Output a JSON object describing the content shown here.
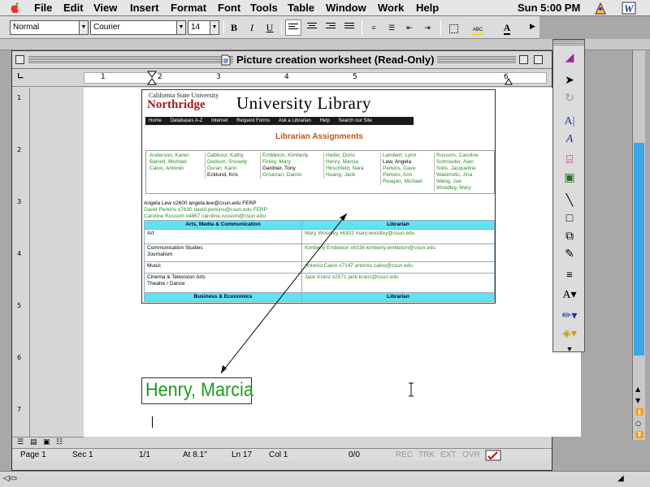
{
  "menubar": {
    "items": [
      "File",
      "Edit",
      "View",
      "Insert",
      "Format",
      "Font",
      "Tools",
      "Table",
      "Window",
      "Work",
      "Help"
    ],
    "clock": "Sun 5:00 PM"
  },
  "toolbar": {
    "style": "Normal",
    "font": "Courier",
    "size": "14",
    "bold": "B",
    "italic": "I",
    "underline": "U"
  },
  "window": {
    "title": "Picture creation worksheet (Read-Only)"
  },
  "ruler": {
    "marks": [
      "1",
      "2",
      "3",
      "4",
      "5",
      "6"
    ]
  },
  "vruler": {
    "marks": [
      "1",
      "2",
      "3",
      "4",
      "5",
      "6",
      "7"
    ]
  },
  "statusbar": {
    "page": "Page  1",
    "sec": "Sec  1",
    "pages": "1/1",
    "at": "At  8.1\"",
    "ln": "Ln  17",
    "col": "Col  1",
    "count": "0/0",
    "rec": "REC",
    "trk": "TRK",
    "ext": "EXT",
    "ovr": "OVR"
  },
  "picture": {
    "csu_line1": "California State University",
    "csu_line2": "Northridge",
    "library_title": "University Library",
    "nav": [
      "Home",
      "Databases A-Z",
      "Internet",
      "Request Forms",
      "Ask a Librarian",
      "Help",
      "Search our Site"
    ],
    "heading": "Librarian Assignments",
    "names_col1": [
      "Anderson, Karen",
      "Barrett, Michael",
      "Calvo, Antonio"
    ],
    "names_col2": [
      "Dabbour, Kathy",
      "Dodson, Snowdy",
      "Duran, Karin",
      "Ecklund, Kris"
    ],
    "names_col3": [
      "Embleton, Kimberly",
      "Finley, Mary",
      "Gardner, Tony",
      "Grisezan, Damin"
    ],
    "names_col4": [
      "Heifer, Doris",
      "Henry, Marcia",
      "Hirschfeld, Nara",
      "Huang, Jack"
    ],
    "names_col5": [
      "Lambert, Lynn",
      "Lew, Angela",
      "Perkins, Dave",
      "Perkins, Ann",
      "Reagan, Michael"
    ],
    "names_col6": [
      "Russom, Caroline",
      "Schroeder, Alan",
      "Solis, Jacqueline",
      "Wakimoto, Jina",
      "Wang, Jue",
      "Woodley, Mary"
    ],
    "contacts": [
      "Angela Lew x2600 angela.lew@csun.edu FERP",
      "David Perkins x7830 david.perkins@csun.edu FERP",
      "Caroline Russom x4867 caroline.russom@csun.edu"
    ],
    "table_head1": [
      "Arts, Media & Communication",
      "Librarian"
    ],
    "rows": [
      [
        "Art",
        "Mary Woodley x6302 mary.woodley@csun.edu"
      ],
      [
        "Communication Studies\nJournalism",
        "Kimberly Embleton x6336 kimberly.embleton@csun.edu"
      ],
      [
        "Music",
        "Antonio Calvo x7147 antonio.calvo@csun.edu"
      ],
      [
        "Cinema & Television Arts\nTheatre / Dance",
        "Jack Kranz x2571 jack.kranz@csun.edu"
      ]
    ],
    "table_head2": [
      "Business & Economics",
      "Librarian"
    ]
  },
  "callout": {
    "text": "Henry, Marcia"
  },
  "colors": {
    "green_text": "#2d8a2d",
    "callout_green": "#1f9a1f",
    "csu_red": "#9b1b1e",
    "table_header": "#5fe3f0",
    "scroll_blue": "#3aa6e8"
  }
}
